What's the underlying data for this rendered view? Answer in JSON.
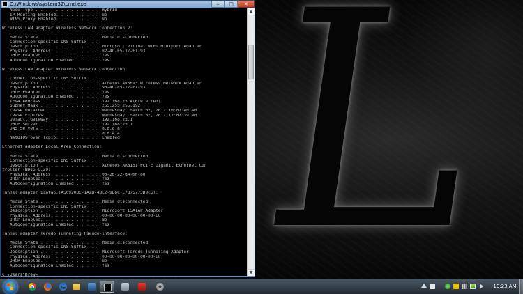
{
  "window": {
    "title": "C:\\Windows\\system32\\cmd.exe",
    "minimize_label": "–",
    "maximize_label": "□",
    "close_label": "✕"
  },
  "console_lines": [
    "   Node Type . . . . . . . . . . . . : Hybrid",
    "   IP Routing Enabled. . . . . . . . : No",
    "   WINS Proxy Enabled. . . . . . . . : No",
    "",
    "Wireless LAN adapter Wireless Network Connection 2:",
    "",
    "   Media State . . . . . . . . . . . : Media disconnected",
    "   Connection-specific DNS Suffix  . :",
    "   Description . . . . . . . . . . . : Microsoft Virtual WiFi Miniport Adapter",
    "   Physical Address. . . . . . . . . : B2-4C-E5-17-F1-93",
    "   DHCP Enabled. . . . . . . . . . . : Yes",
    "   Autoconfiguration Enabled . . . . : Yes",
    "",
    "Wireless LAN adapter Wireless Network Connection:",
    "",
    "   Connection-specific DNS Suffix  . :",
    "   Description . . . . . . . . . . . : Atheros AR5B93 Wireless Network Adapter",
    "   Physical Address. . . . . . . . . : 90-4C-E5-17-F1-93",
    "   DHCP Enabled. . . . . . . . . . . : Yes",
    "   Autoconfiguration Enabled . . . . : Yes",
    "   IPv4 Address. . . . . . . . . . . : 192.168.25.4(Preferred)",
    "   Subnet Mask . . . . . . . . . . . : 255.255.255.192",
    "   Lease Obtained. . . . . . . . . . : Wednesday, March 07, 2012 10:07:40 AM",
    "   Lease Expires . . . . . . . . . . : Wednesday, March 07, 2012 11:07:39 AM",
    "   Default Gateway . . . . . . . . . : 192.168.25.1",
    "   DHCP Server . . . . . . . . . . . : 192.168.25.1",
    "   DNS Servers . . . . . . . . . . . : 8.8.8.8",
    "                                       8.8.4.4",
    "   NetBIOS over Tcpip. . . . . . . . : Enabled",
    "",
    "Ethernet adapter Local Area Connection:",
    "",
    "   Media State . . . . . . . . . . . : Media disconnected",
    "   Connection-specific DNS Suffix  . :",
    "   Description . . . . . . . . . . . : Atheros AR8131 PCI-E Gigabit Ethernet Con",
    "troller (NDIS 6.20)",
    "   Physical Address. . . . . . . . . : 00-26-22-6A-0F-80",
    "   DHCP Enabled. . . . . . . . . . . : Yes",
    "   Autoconfiguration Enabled . . . . : Yes",
    "",
    "Tunnel adapter isatap.{A5G920BC-1A2B-4BE2-9E6C-E7875773D9C6}:",
    "",
    "   Media State . . . . . . . . . . . : Media disconnected",
    "   Connection-specific DNS Suffix  . :",
    "   Description . . . . . . . . . . . : Microsoft ISATAP Adapter",
    "   Physical Address. . . . . . . . . : 00-00-00-00-00-00-00-E0",
    "   DHCP Enabled. . . . . . . . . . . : No",
    "   Autoconfiguration Enabled . . . . : Yes",
    "",
    "Tunnel adapter Teredo Tunneling Pseudo-Interface:",
    "",
    "   Media State . . . . . . . . . . . : Media disconnected",
    "   Connection-specific DNS Suffix  . :",
    "   Description . . . . . . . . . . . : Microsoft Teredo Tunneling Adapter",
    "   Physical Address. . . . . . . . . : 00-00-00-00-00-00-00-E0",
    "   DHCP Enabled. . . . . . . . . . . : No",
    "   Autoconfiguration Enabled . . . . : Yes",
    "",
    "C:\\Users\\Drew>"
  ],
  "taskbar": {
    "pinned": [
      {
        "name": "chrome-icon",
        "active": false
      },
      {
        "name": "firefox-icon",
        "active": false
      },
      {
        "name": "internet-explorer-icon",
        "active": false
      },
      {
        "name": "folder-icon",
        "active": false
      },
      {
        "name": "media-player-icon",
        "active": false
      },
      {
        "name": "command-prompt-icon",
        "active": true
      },
      {
        "name": "tool-icon",
        "active": false
      },
      {
        "name": "pdf-icon",
        "active": false
      },
      {
        "name": "gear-icon",
        "active": false
      }
    ],
    "clock": "10:23 AM"
  },
  "wallpaper_letter": "L"
}
